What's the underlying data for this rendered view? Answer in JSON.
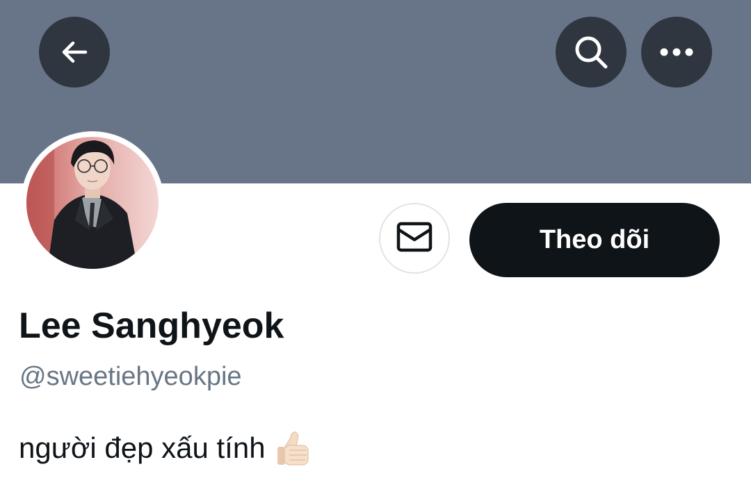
{
  "header": {
    "back_icon": "arrow-left-icon",
    "search_icon": "search-icon",
    "more_icon": "more-horizontal-icon",
    "banner_color": "#687589"
  },
  "profile": {
    "avatar_description": "profile-photo",
    "display_name": "Lee Sanghyeok",
    "handle": "@sweetiehyeokpie",
    "bio": "người đẹp xấu tính",
    "bio_emoji": "thumbs-up-icon"
  },
  "actions": {
    "message_icon": "envelope-icon",
    "follow_label": "Theo dõi",
    "follow_bg": "#0f1419"
  }
}
